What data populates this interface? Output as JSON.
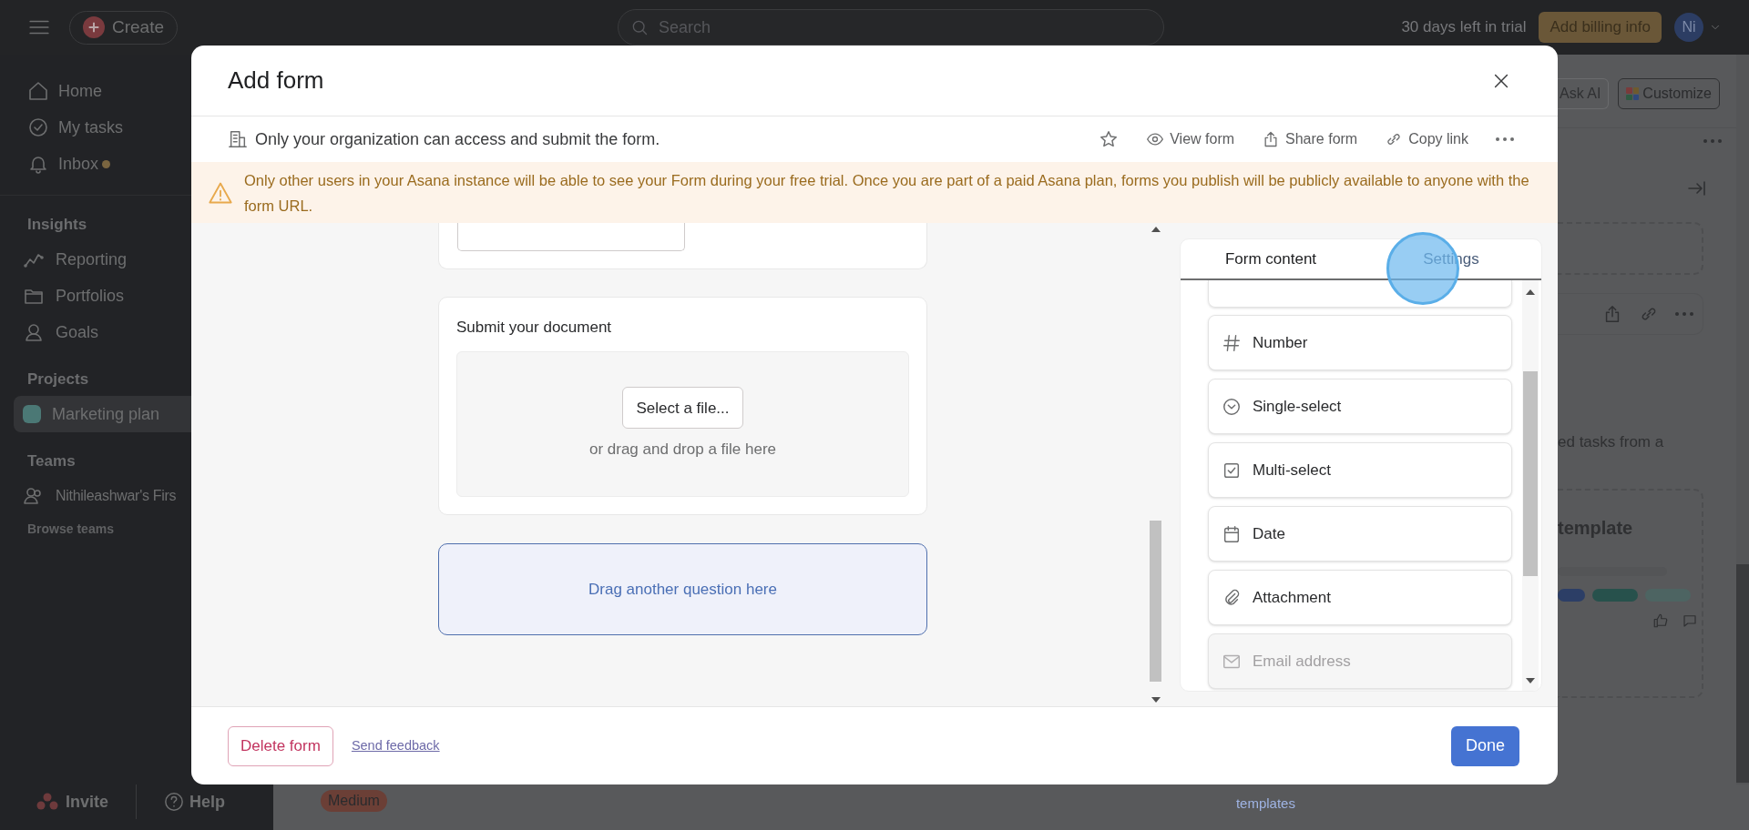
{
  "topbar": {
    "create": "Create",
    "search_placeholder": "Search",
    "trial": "30 days left in trial",
    "billing_button": "Add billing info",
    "avatar": "Ni"
  },
  "sidebar": {
    "nav": [
      {
        "label": "Home",
        "unread": false
      },
      {
        "label": "My tasks",
        "unread": false
      },
      {
        "label": "Inbox",
        "unread": true
      }
    ],
    "sections": [
      {
        "title": "Insights",
        "items": [
          {
            "label": "Reporting"
          },
          {
            "label": "Portfolios"
          },
          {
            "label": "Goals"
          }
        ]
      },
      {
        "title": "Projects",
        "items": [
          {
            "label": "Marketing plan",
            "color": "#4b7875",
            "selected": true
          }
        ]
      },
      {
        "title": "Teams",
        "items": [
          {
            "label": "Nithileashwar's Firs"
          }
        ],
        "link": "Browse teams"
      }
    ],
    "footer": {
      "invite": "Invite",
      "help": "Help"
    }
  },
  "background": {
    "header_buttons": [
      "Ask AI",
      "Customize"
    ],
    "partial_text": "ed tasks from a",
    "template_title": "template",
    "priority_tag": "Medium",
    "templates_link": "templates"
  },
  "modal": {
    "title": "Add form",
    "access_note": "Only your organization can access and submit the form.",
    "actions": [
      "View form",
      "Share form",
      "Copy link"
    ],
    "warning": "Only other users in your Asana instance will be able to see your Form during your free trial. Once you are part of a paid Asana plan, forms you publish will be publicly available to anyone with the form URL.",
    "question": {
      "label": "Submit your document",
      "select_button": "Select a file...",
      "drop_hint": "or drag and drop a file here"
    },
    "drop_target": "Drag another question here",
    "tabs": [
      {
        "label": "Form content",
        "selected": true
      },
      {
        "label": "Settings",
        "selected": false
      }
    ],
    "field_types": [
      {
        "label": "Number",
        "disabled": false
      },
      {
        "label": "Single-select",
        "disabled": false
      },
      {
        "label": "Multi-select",
        "disabled": false
      },
      {
        "label": "Date",
        "disabled": false
      },
      {
        "label": "Attachment",
        "disabled": false
      },
      {
        "label": "Email address",
        "disabled": true
      }
    ],
    "footer": {
      "delete": "Delete form",
      "feedback": "Send feedback",
      "done": "Done"
    }
  }
}
